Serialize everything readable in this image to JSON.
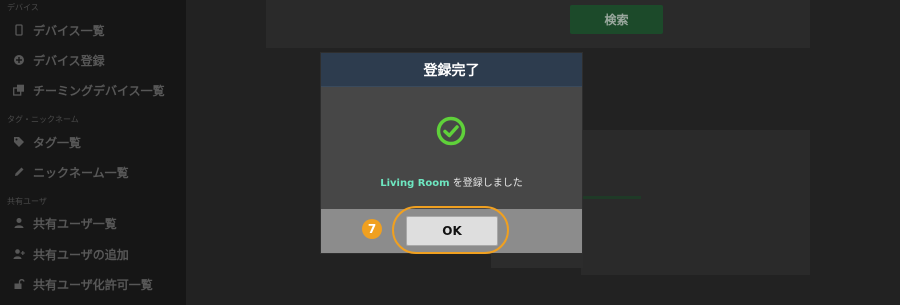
{
  "sidebar": {
    "sections": [
      {
        "label": "デバイス",
        "items": [
          {
            "label": "デバイス一覧",
            "icon": "tablet-icon"
          },
          {
            "label": "デバイス登録",
            "icon": "plus-circle-icon"
          },
          {
            "label": "チーミングデバイス一覧",
            "icon": "clone-icon"
          }
        ]
      },
      {
        "label": "タグ・ニックネーム",
        "items": [
          {
            "label": "タグ一覧",
            "icon": "tags-icon"
          },
          {
            "label": "ニックネーム一覧",
            "icon": "pencil-icon"
          }
        ]
      },
      {
        "label": "共有ユーザ",
        "items": [
          {
            "label": "共有ユーザ一覧",
            "icon": "user-icon"
          },
          {
            "label": "共有ユーザの追加",
            "icon": "user-plus-icon"
          },
          {
            "label": "共有ユーザ化許可一覧",
            "icon": "unlock-icon"
          }
        ]
      }
    ]
  },
  "main": {
    "search_label": "検索"
  },
  "modal": {
    "title": "登録完了",
    "message_name": "Living Room",
    "message_suffix": " を登録しました",
    "ok_label": "OK",
    "check_icon": "check-circle-icon"
  },
  "annotation": {
    "step_number": "7",
    "color": "#f0a020"
  },
  "colors": {
    "modal_header": "#2d3c4e",
    "success_green": "#5fd13a",
    "name_highlight": "#6ee6c0"
  }
}
